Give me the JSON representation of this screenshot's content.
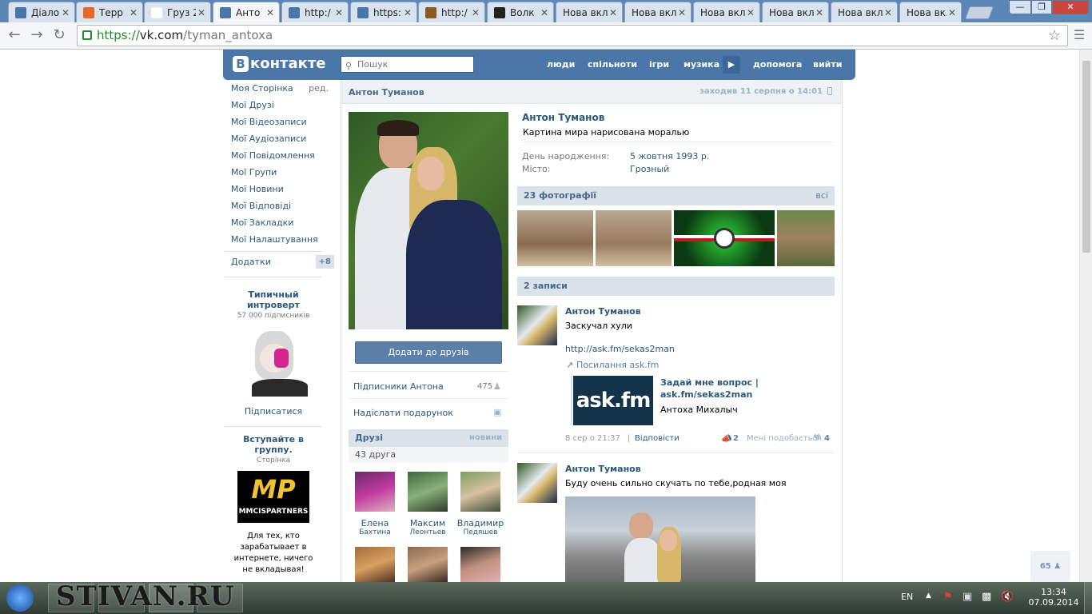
{
  "tabs": [
    {
      "title": "Діало",
      "fav": "#4a76a8",
      "active": false
    },
    {
      "title": "Терр",
      "fav": "#e8662a",
      "active": false
    },
    {
      "title": "Груз 2",
      "fav": "#ffffff",
      "active": false
    },
    {
      "title": "Анто",
      "fav": "#4a76a8",
      "active": true
    },
    {
      "title": "http:/",
      "fav": "#4a76a8",
      "active": false
    },
    {
      "title": "https:",
      "fav": "#4a76a8",
      "active": false
    },
    {
      "title": "http:/",
      "fav": "#8a5a20",
      "active": false
    },
    {
      "title": "Волк",
      "fav": "#222222",
      "active": false
    },
    {
      "title": "Нова вкл",
      "fav": "none",
      "active": false
    },
    {
      "title": "Нова вкл",
      "fav": "none",
      "active": false
    },
    {
      "title": "Нова вкл",
      "fav": "none",
      "active": false
    },
    {
      "title": "Нова вкл",
      "fav": "none",
      "active": false
    },
    {
      "title": "Нова вкл",
      "fav": "none",
      "active": false
    },
    {
      "title": "Нова вкл",
      "fav": "none",
      "active": false
    }
  ],
  "browser": {
    "url_scheme": "https://",
    "url_host": "vk.com",
    "url_path": "/tyman_antoxa"
  },
  "vk": {
    "logo": "контакте",
    "logo_b": "B",
    "search_placeholder": "Пошук",
    "nav": [
      "люди",
      "спільноти",
      "ігри",
      "музика",
      "допомога",
      "вийти"
    ],
    "left_menu": [
      "Моя Сторінка",
      "Мої Друзі",
      "Мої Відеозаписи",
      "Мої Аудіозаписи",
      "Мої Повідомлення",
      "Мої Групи",
      "Мої Новини",
      "Мої Відповіді",
      "Мої Закладки",
      "Мої Налаштування"
    ],
    "edit": "ред.",
    "apps": "Додатки",
    "apps_badge": "+8",
    "ad1": {
      "title": "Типичный интроверт",
      "sub": "57 000 підписників",
      "action": "Підписатися"
    },
    "ad2": {
      "title": "Вступайте в группу.",
      "sub": "Сторінка",
      "logo": "MP",
      "logo_sub": "MMCISPARTNERS",
      "text": "Для тех, кто зарабатывает в интернете, ничего не вкладывая!"
    },
    "profile": {
      "header_name": "Антон Туманов",
      "last_seen": "заходив 11 серпня о 14:01",
      "name": "Антон Туманов",
      "status": "Картина мира нарисована моралью",
      "bday_label": "День народження:",
      "bday": "5 жовтня 1993 р.",
      "city_label": "Місто:",
      "city": "Грозный",
      "add_friend": "Додати до друзів",
      "followers_label": "Підписники Антона",
      "followers": "475",
      "gift": "Надіслати подарунок",
      "friends_label": "Друзі",
      "friends_news": "новини",
      "friends_count": "43 друга",
      "friends": [
        {
          "first": "Елена",
          "last": "Бахтина"
        },
        {
          "first": "Максим",
          "last": "Леонтьев"
        },
        {
          "first": "Владимир",
          "last": "Педяшев"
        }
      ],
      "photos_label": "23 фотографії",
      "photos_all": "всі",
      "posts_label": "2 записи",
      "post1": {
        "author": "Антон Туманов",
        "text": "Заскучал хули",
        "link": "http://ask.fm/sekas2man",
        "share_label": "Посилання ask.fm",
        "card_title": "Задай мне вопрос | ask.fm/sekas2man",
        "card_sub": "Антоха Михалыч",
        "card_logo": "ask.fm",
        "date": "8 сер о 21:37",
        "reply": "Відповісти",
        "reposts": "2",
        "like_label": "Мені подобається",
        "likes": "4"
      },
      "post2": {
        "author": "Антон Туманов",
        "text": "Буду очень сильно скучать по тебе,родная моя"
      }
    },
    "online_count": "65"
  },
  "taskbar": {
    "watermark": "STIVAN.RU",
    "lang": "EN",
    "time": "13:34",
    "date": "07.09.2014"
  }
}
